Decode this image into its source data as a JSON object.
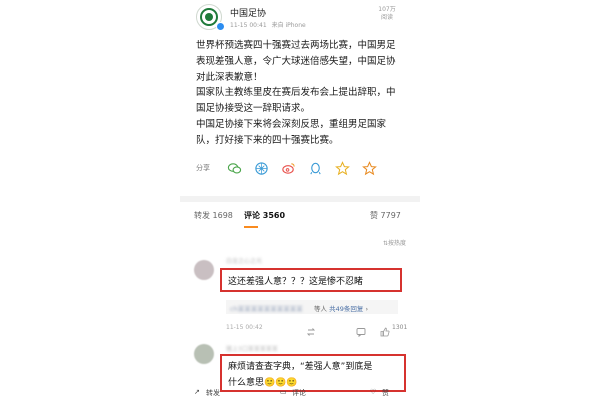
{
  "post": {
    "author": "中国足协",
    "timestamp": "11-15 00:41",
    "source": "来自 iPhone",
    "views_count": "107万",
    "views_label": "阅读",
    "paragraphs": [
      "世界杯预选赛四十强赛过去两场比赛，中国男足表现差强人意，令广大球迷倍感失望，中国足协对此深表歉意！",
      "国家队主教练里皮在赛后发布会上提出辞职，中国足协接受这一辞职请求。",
      "中国足协接下来将会深刻反思，重组男足国家队，打好接下来的四十强赛比赛。"
    ]
  },
  "share": {
    "label": "分享",
    "icons": [
      "wechat-icon",
      "moments-icon",
      "weibo-icon",
      "qq-icon",
      "qzone-icon",
      "favorite-icon"
    ]
  },
  "tabs": {
    "repost": "转发 1698",
    "comments": "评论 3560",
    "likes": "赞 7797"
  },
  "sort_label": "按热度",
  "comments": [
    {
      "name": "白龙之心之光",
      "text": "这还差强人意？？？这是惨不忍睹",
      "reply_user": "ch某某某某某某某某某某",
      "reply_suffix": "等人",
      "reply_link": "共49条回复",
      "time": "11-15 00:42",
      "likes": "1301"
    },
    {
      "name": "猪上3口某某某某某",
      "text_line1": "麻烦请查查字典，“差强人意”到底是",
      "text_line2": "什么意思🙂🙂🙂"
    }
  ],
  "bottom_bar": {
    "repost": "转发",
    "comment": "评论",
    "like": "赞"
  },
  "colors": {
    "highlight_border": "#d6322f",
    "accent_orange": "#f98b1f",
    "link_blue": "#4a6fa5"
  }
}
